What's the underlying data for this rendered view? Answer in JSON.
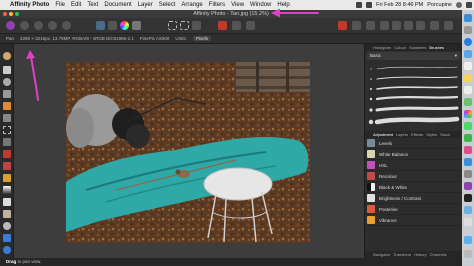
{
  "menubar": {
    "app": "Affinity Photo",
    "items": [
      "File",
      "Edit",
      "Text",
      "Document",
      "Layer",
      "Select",
      "Arrange",
      "Filters",
      "View",
      "Window",
      "Help"
    ],
    "clock": "Fri Feb 28  8:46 PM",
    "user": "Porcupine"
  },
  "window": {
    "title": "Affinity Photo - Tan.jpg (15.2%)"
  },
  "contextbar": {
    "pan_label": "Pan",
    "doc_info": "4288 × 3216px, 13.79MP, RGBA/8 - sRGB IEC61966-2.1",
    "camera": "FinePix AX500",
    "units_label": "Units:",
    "units_value": "Pixels"
  },
  "panels": {
    "tabs": [
      "Histogram",
      "Colour",
      "Swatches",
      "Brushes"
    ],
    "brush_category": "Basic",
    "adjustment_tabs": [
      "Adjustment",
      "Layers",
      "Effects",
      "Styles",
      "Stock"
    ],
    "adjustments": [
      {
        "label": "Levels",
        "color": "#7a8a9a"
      },
      {
        "label": "White Balance",
        "color": "#d9d4b0"
      },
      {
        "label": "HSL",
        "color": "#c44fbf"
      },
      {
        "label": "Recolour",
        "color": "#c04a4a"
      },
      {
        "label": "Black & White",
        "color": "#888888"
      },
      {
        "label": "Brightness / Contrast",
        "color": "#e0e0e0"
      },
      {
        "label": "Posterise",
        "color": "#d85a3a"
      },
      {
        "label": "Vibrance",
        "color": "#e8a030"
      }
    ],
    "bottom_tabs": [
      "Navigator",
      "Transform",
      "History",
      "Channels"
    ]
  },
  "status": {
    "bold": "Drag",
    "text": "to pan view."
  },
  "colors": {
    "annotation": "#e040c8",
    "accent": "#2f7de1"
  },
  "icons": {
    "toolbar": [
      "persona-photo-icon",
      "persona-liquify-icon",
      "persona-develop-icon",
      "persona-tonemap-icon",
      "persona-export-icon",
      "view-mode-icon",
      "assistant-icon",
      "colour-wheel-icon",
      "levels-icon",
      "selection-rect-icon",
      "selection-brush-icon",
      "invert-icon",
      "quick-mask-icon",
      "arrange-icon",
      "snapping-icon"
    ]
  }
}
